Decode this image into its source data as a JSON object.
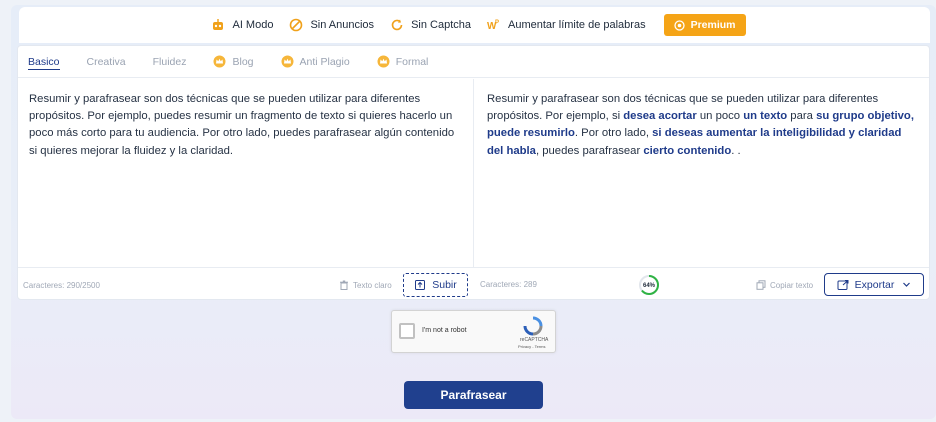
{
  "features": [
    {
      "label": "AI Modo",
      "icon": "robot-icon"
    },
    {
      "label": "Sin Anuncios",
      "icon": "no-ads-icon"
    },
    {
      "label": "Sin Captcha",
      "icon": "refresh-icon"
    },
    {
      "label": "Aumentar límite de palabras",
      "icon": "wp-icon"
    }
  ],
  "premium_label": "Premium",
  "tabs": [
    {
      "label": "Basico",
      "active": true
    },
    {
      "label": "Creativa"
    },
    {
      "label": "Fluidez"
    },
    {
      "label": "Blog",
      "crown": true
    },
    {
      "label": "Anti Plagio",
      "crown": true
    },
    {
      "label": "Formal",
      "crown": true
    }
  ],
  "input_text": "Resumir y parafrasear son dos técnicas que se pueden utilizar para diferentes propósitos. Por ejemplo, puedes resumir un fragmento de texto si quieres hacerlo un poco más corto para tu audiencia. Por otro lado, puedes parafrasear algún contenido si quieres mejorar la fluidez y la claridad.",
  "output": {
    "s1": " Resumir y parafrasear son dos técnicas que se pueden utilizar para diferentes propósitos.   Por ejemplo, si ",
    "h1": "desea acortar",
    "s2": " un poco ",
    "h2": "un texto",
    "s3": " para ",
    "h3": "su grupo objetivo, puede resumirlo",
    "s4": ".   Por otro lado, ",
    "h4": "si deseas aumentar la inteligibilidad y claridad del habla",
    "s5": ", puedes parafrasear ",
    "h5": "cierto contenido",
    "s6": ".   ."
  },
  "footer": {
    "chars_left": "Caracteres: 290/2500",
    "clear_label": "Texto claro",
    "upload_label": "Subir",
    "chars_right": "Caracteres: 289",
    "gauge_label": "64%",
    "gauge_value": 0.64,
    "copy_label": "Copiar texto",
    "export_label": "Exportar"
  },
  "captcha": {
    "label": "I'm not a robot",
    "brand": "reCAPTCHA",
    "terms": "Privacy - Terms"
  },
  "submit_label": "Parafrasear",
  "colors": {
    "accent": "#20408e",
    "premium": "#f5a416",
    "icon_orange": "#f0a11a",
    "gauge_green": "#2fb344"
  }
}
